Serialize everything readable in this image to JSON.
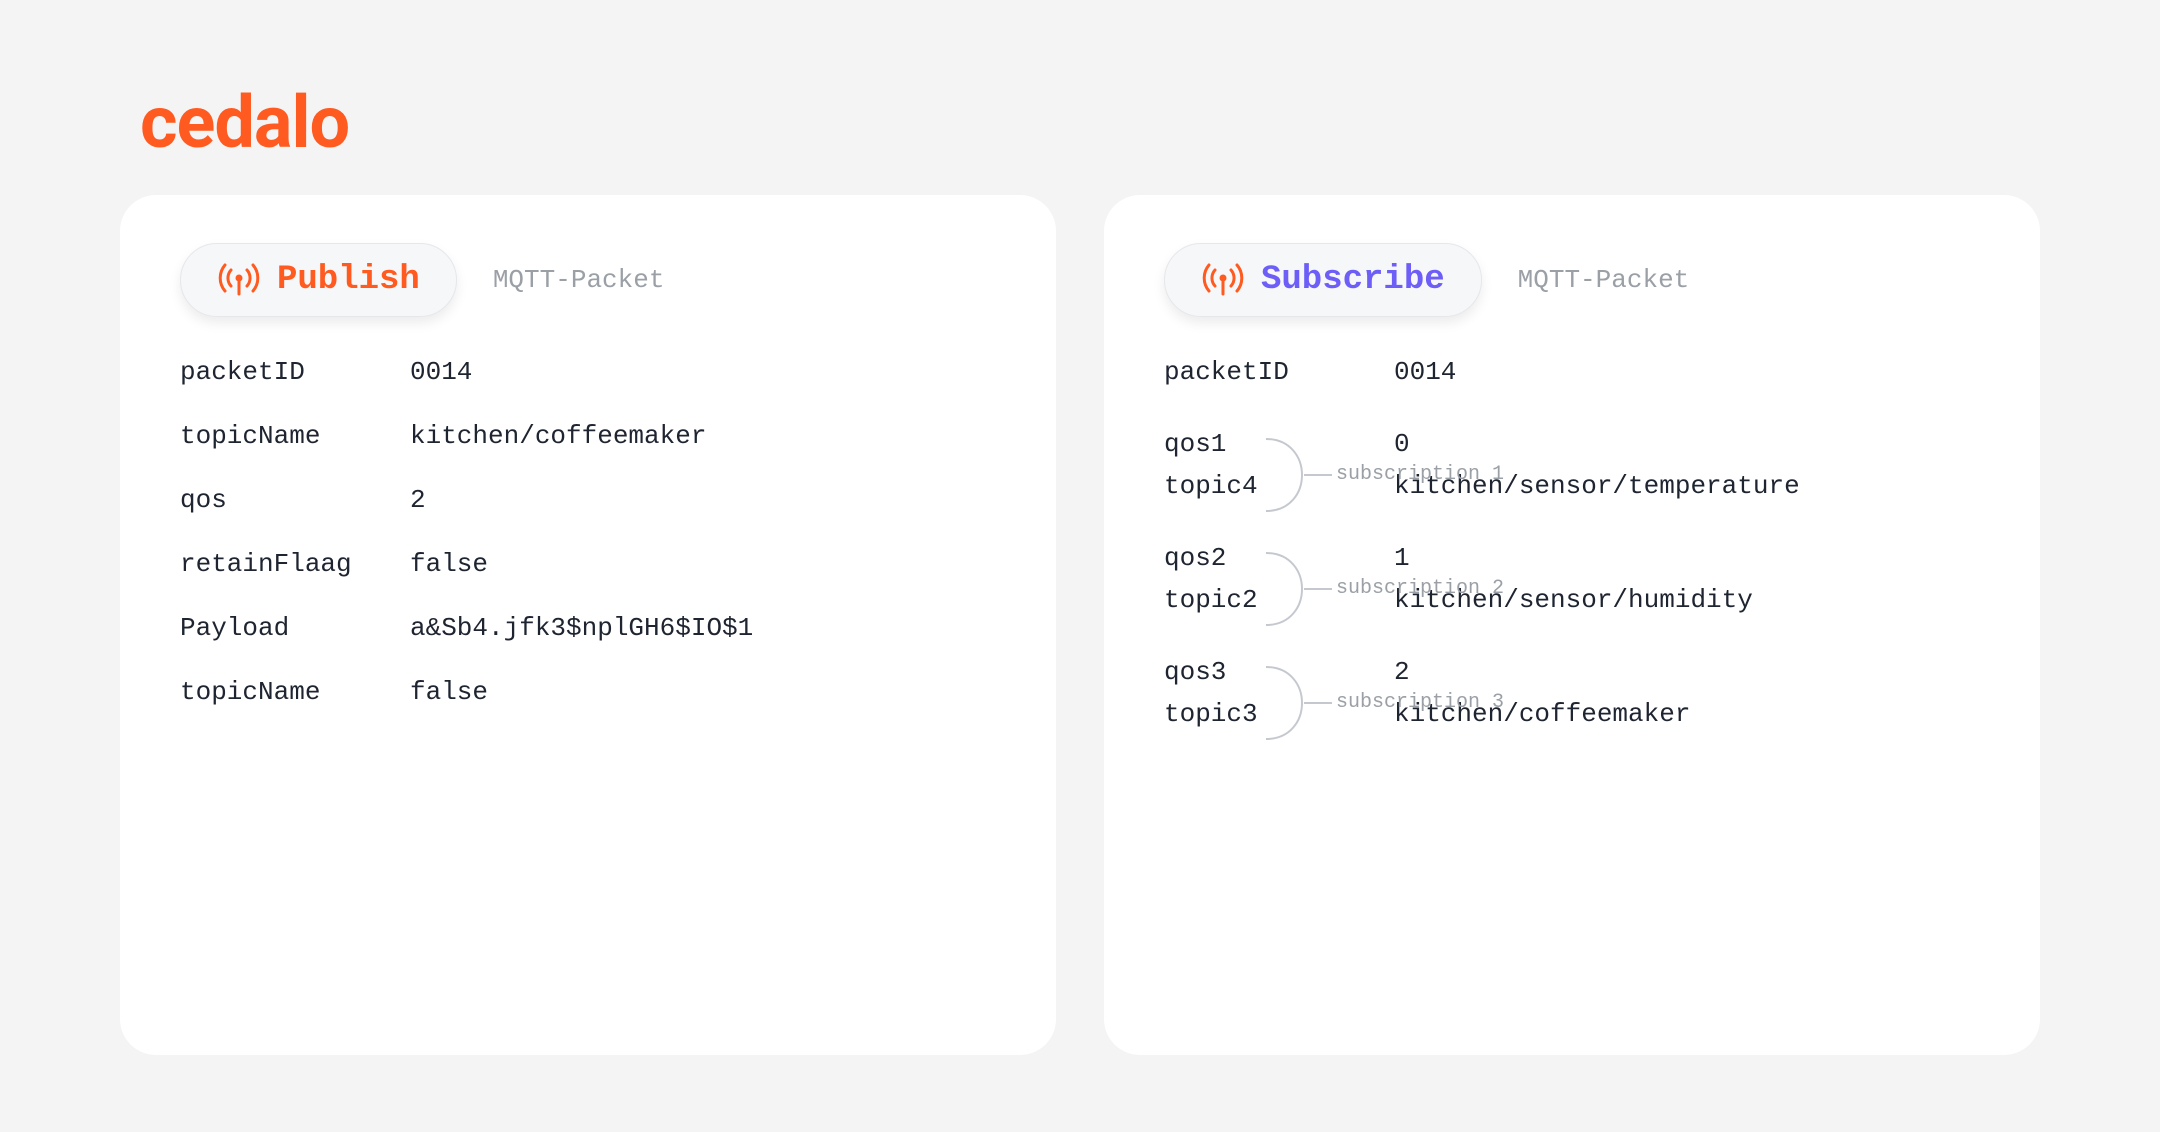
{
  "brand": {
    "name": "cedalo"
  },
  "publish_card": {
    "pill_label": "Publish",
    "subtitle": "MQTT-Packet",
    "rows": [
      {
        "k": "packetID",
        "v": "0014"
      },
      {
        "k": "topicName",
        "v": "kitchen/coffeemaker"
      },
      {
        "k": "qos",
        "v": "2"
      },
      {
        "k": "retainFlaag",
        "v": "false"
      },
      {
        "k": "Payload",
        "v": "a&Sb4.jfk3$nplGH6$IO$1"
      },
      {
        "k": "topicName",
        "v": "false"
      }
    ]
  },
  "subscribe_card": {
    "pill_label": "Subscribe",
    "subtitle": "MQTT-Packet",
    "packetID_k": "packetID",
    "packetID_v": "0014",
    "subscriptions": [
      {
        "anno": "subscription 1",
        "qos_k": "qos1",
        "qos_v": "0",
        "topic_k": "topic4",
        "topic_v": "kitchen/sensor/temperature"
      },
      {
        "anno": "subscription 2",
        "qos_k": "qos2",
        "qos_v": "1",
        "topic_k": "topic2",
        "topic_v": "kitchen/sensor/humidity"
      },
      {
        "anno": "subscription 3",
        "qos_k": "qos3",
        "qos_v": "2",
        "topic_k": "topic3",
        "topic_v": "kitchen/coffeemaker"
      }
    ]
  },
  "colors": {
    "orange": "#ff5a1f",
    "purple": "#6d5ef7"
  }
}
